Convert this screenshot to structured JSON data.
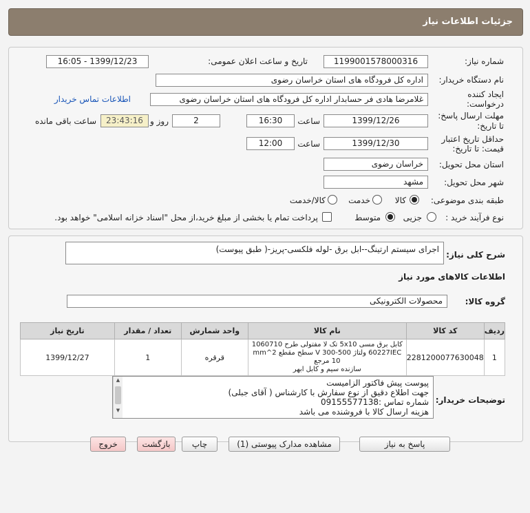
{
  "window_title": "جزئیات اطلاعات نیاز",
  "fields": {
    "need_number_label": "شماره نیاز:",
    "need_number": "1199001578000316",
    "announce_label": "تاریخ و ساعت اعلان عمومی:",
    "announce_value": "1399/12/23 - 16:05",
    "buyer_label": "نام دستگاه خریدار:",
    "buyer_value": "اداره کل فرودگاه های استان خراسان رضوی",
    "creator_label_1": "ایجاد کننده",
    "creator_label_2": "درخواست:",
    "creator_value": "غلامرضا هادی فر حسابدار اداره کل فرودگاه های استان خراسان رضوی",
    "contact_link": "اطلاعات تماس خریدار",
    "deadline_label_1": "مهلت ارسال پاسخ:",
    "deadline_label_2": "تا تاریخ:",
    "deadline_date": "1399/12/26",
    "time_label": "ساعت",
    "deadline_time": "16:30",
    "days_value": "2",
    "days_label": "روز و",
    "remaining_value": "23:43:16",
    "remaining_label": "ساعت باقی مانده",
    "validity_label_1": "حداقل تاریخ اعتبار",
    "validity_label_2": "قیمت: تا تاریخ:",
    "validity_date": "1399/12/30",
    "validity_time": "12:00",
    "province_label": "استان محل تحویل:",
    "province_value": "خراسان رضوی",
    "city_label": "شهر محل تحویل:",
    "city_value": "مشهد",
    "category_label": "طبقه بندی موضوعی:",
    "category_options": [
      "کالا",
      "خدمت",
      "کالا/خدمت"
    ],
    "process_label": "نوع فرآیند خرید :",
    "process_options": [
      "جزیی",
      "متوسط"
    ],
    "payment_note": "پرداخت تمام یا بخشی از مبلغ خرید،از محل \"اسناد خزانه اسلامی\" خواهد بود."
  },
  "description": {
    "label": "شرح کلی نیاز:",
    "value": "اجرای سیستم ارتینگ--ابل برق -لوله فلکسی-پریز-( طبق پیوست)"
  },
  "goods_section_title": "اطلاعات کالاهای مورد نیاز",
  "goods_group": {
    "label": "گروه کالا:",
    "value": "محصولات الکترونیکی"
  },
  "table": {
    "headers": [
      "ردیف",
      "کد کالا",
      "نام کالا",
      "واحد شمارش",
      "تعداد / مقدار",
      "تاریخ نیاز"
    ],
    "rows": [
      {
        "row": "1",
        "code": "2281200077630048",
        "name_line1": "کابل برق مسی 5x10 تک لا مفتولی طرح 1060710",
        "name_line2": "60227IEC ولتاژ V 300-500 سطح مقطع mm^2 10 مرجع",
        "name_line3": "سازنده سیم و کابل ابهر",
        "unit": "قرقره",
        "qty": "1",
        "date": "1399/12/27"
      }
    ]
  },
  "buyer_notes": {
    "label": "توضیحات خریدار:",
    "lines": [
      "پیوست پیش فاکتور الزامیست",
      "جهت اطلاع دقیق از نوع سفارش با کارشناس   ( آقای جبلی)",
      "شماره تماس :09155577138",
      "هزینه ارسال کالا با فروشنده می باشد"
    ]
  },
  "buttons": {
    "reply": "پاسخ به نیاز",
    "view_docs": "مشاهده مدارک پیوستی (1)",
    "print": "چاپ",
    "back": "بازگشت",
    "exit": "خروج"
  },
  "colors": {
    "title_bar": "#8c7e6e",
    "link": "#1a56b8",
    "remaining_bg": "#f6f0c8",
    "pink_button": "#f4c7c7"
  }
}
